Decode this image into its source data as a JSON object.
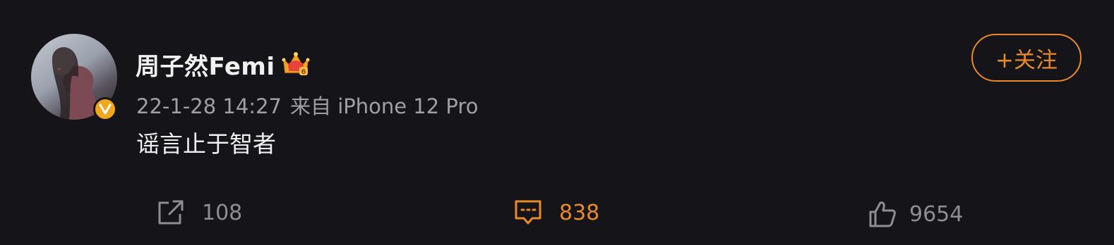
{
  "post": {
    "author": {
      "name": "周子然Femi",
      "avatar_alt": "avatar",
      "verified_badge": "V",
      "crown_badge_level": "6"
    },
    "timestamp": "22-1-28 14:27",
    "source": "来自 iPhone 12 Pro",
    "text": "谣言止于智者"
  },
  "follow_button": {
    "label": "+关注"
  },
  "actions": {
    "share_count": "108",
    "comment_count": "838",
    "like_count": "9654"
  },
  "colors": {
    "background": "#151519",
    "accent": "#e8892b",
    "muted": "#8e8e92",
    "verified": "#f2a81d"
  },
  "icons": {
    "share": "share-icon",
    "comment": "comment-icon",
    "like": "like-icon",
    "crown": "crown-icon",
    "verified": "verified-icon"
  }
}
